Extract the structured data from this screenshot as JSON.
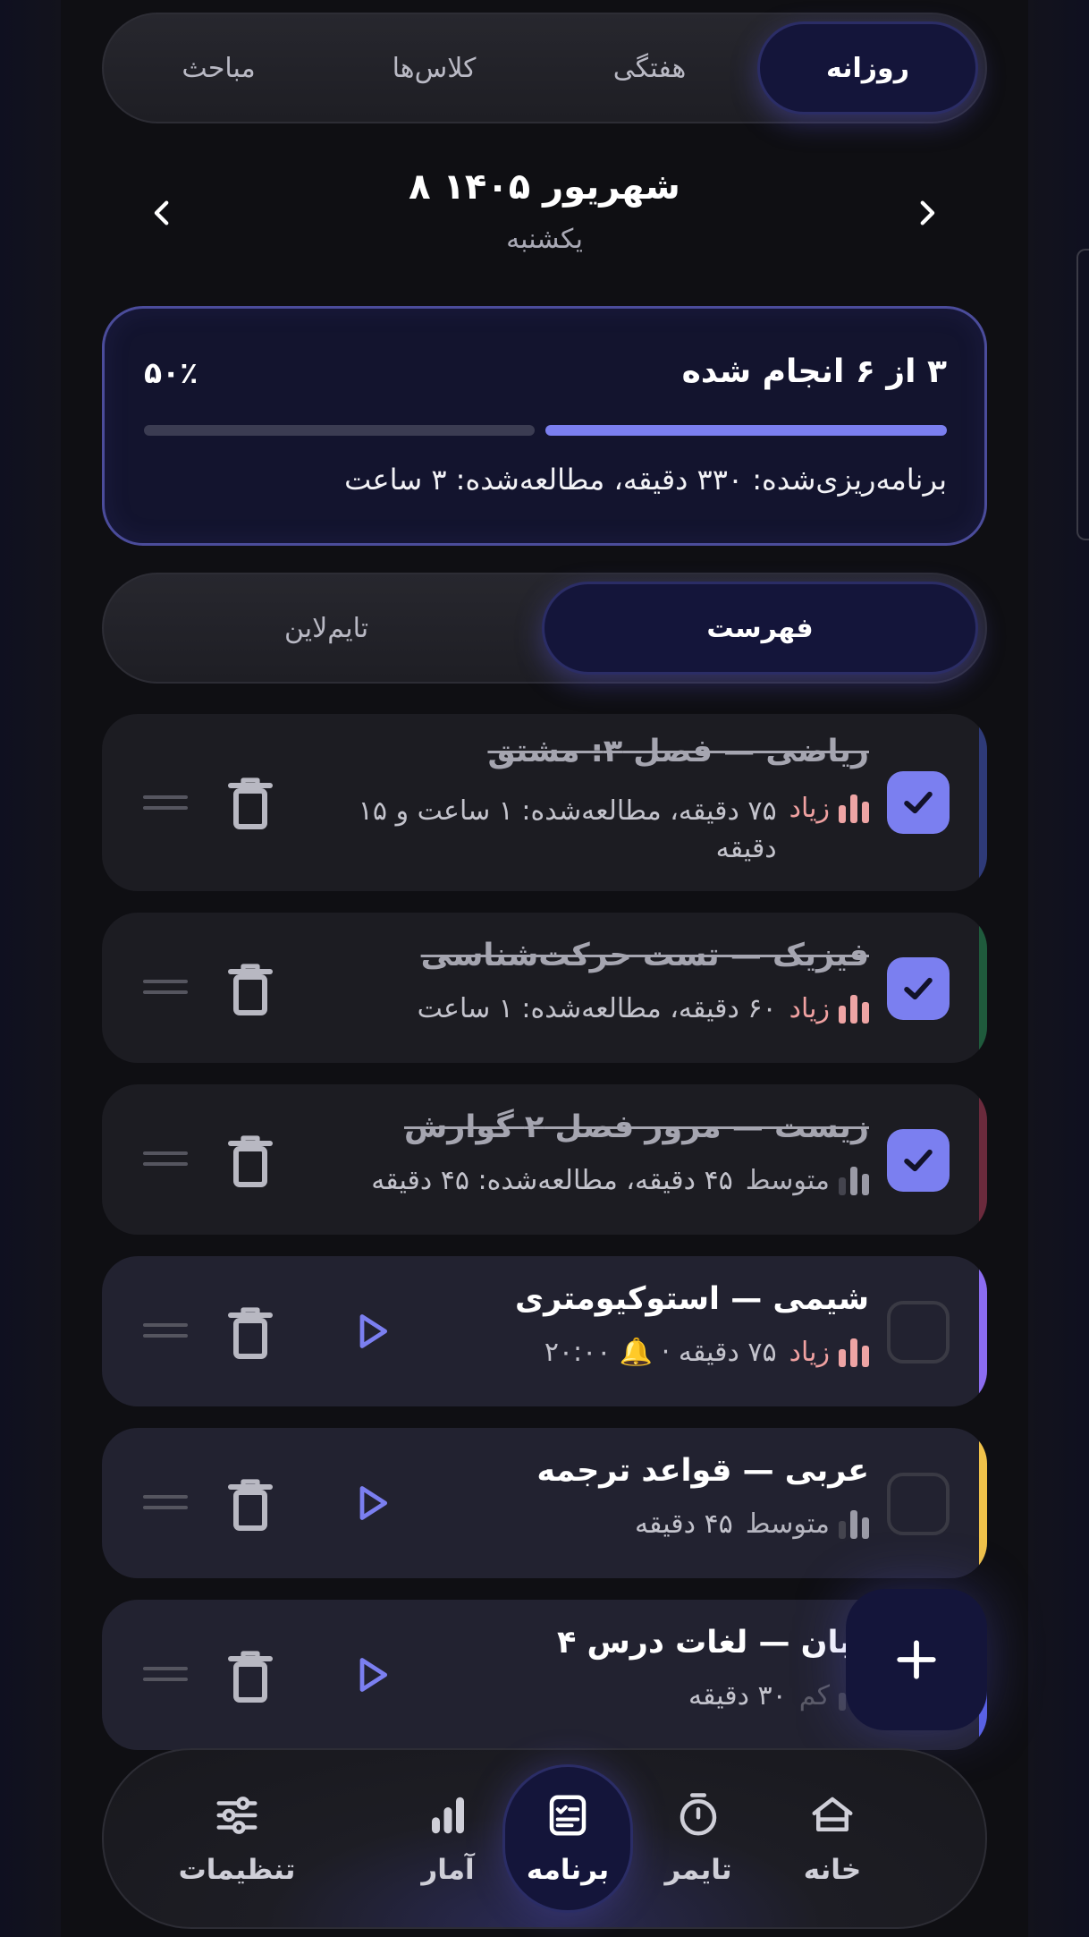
{
  "top_tabs": {
    "daily": "روزانه",
    "weekly": "هفتگی",
    "classes": "کلاس‌ها",
    "topics": "مباحث"
  },
  "date": {
    "title": "۸ شهریور ۱۴۰۵",
    "weekday": "یکشنبه"
  },
  "progress": {
    "done_text": "۳ از ۶ انجام شده",
    "percent_text": "۵۰٪",
    "fraction": 0.5,
    "stats_text": "برنامه‌ریزی‌شده: ۳۳۰ دقیقه، مطالعه‌شده: ۳ ساعت"
  },
  "view_tabs": {
    "list": "فهرست",
    "timeline": "تایم‌لاین"
  },
  "tasks": [
    {
      "title": "ریاضی — فصل ۳: مشتق",
      "priority": "زیاد",
      "level": "high",
      "meta": "۷۵ دقیقه، مطالعه‌شده: ۱ ساعت و ۱۵",
      "meta2": "دقیقه",
      "done": true,
      "color": "#2e3a78"
    },
    {
      "title": "فیزیک — تست حرکت‌شناسی",
      "priority": "زیاد",
      "level": "high",
      "meta": "۶۰ دقیقه، مطالعه‌شده: ۱ ساعت",
      "done": true,
      "color": "#1f5a3c"
    },
    {
      "title": "زیست — مرور فصل ۲ گوارش",
      "priority": "متوسط",
      "level": "mid",
      "meta": "۴۵ دقیقه، مطالعه‌شده: ۴۵ دقیقه",
      "done": true,
      "color": "#6a2a3c"
    },
    {
      "title": "شیمی — استوکیومتری",
      "priority": "زیاد",
      "level": "high",
      "meta": "۷۵ دقیقه · 🔔 ۲۰:۰۰",
      "done": false,
      "color": "#8b6cf0"
    },
    {
      "title": "عربی — قواعد ترجمه",
      "priority": "متوسط",
      "level": "mid",
      "meta": "۴۵ دقیقه",
      "done": false,
      "color": "#f0c24a"
    },
    {
      "title": "زبان — لغات درس ۴",
      "priority": "کم",
      "level": "low",
      "meta": "۳۰ دقیقه",
      "done": false,
      "color": "#5a63e6"
    }
  ],
  "nav": {
    "home": "خانه",
    "timer": "تایمر",
    "plan": "برنامه",
    "stats": "آمار",
    "settings": "تنظیمات"
  },
  "colors": {
    "accent": "#7b7ff0",
    "active_bg": "#14153a",
    "high_priority": "#f0a1a1"
  }
}
